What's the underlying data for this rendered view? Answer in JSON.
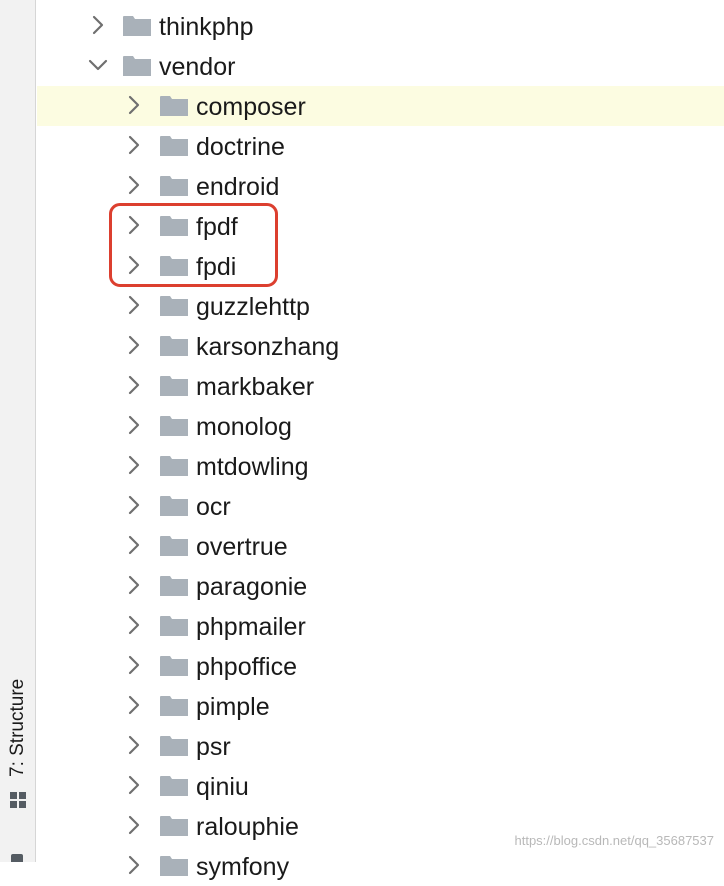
{
  "side_panel": {
    "structure_tab_label": "7: Structure"
  },
  "tree": {
    "root_items": [
      {
        "name": "thinkphp",
        "expanded": false
      },
      {
        "name": "vendor",
        "expanded": true
      }
    ],
    "vendor_children": [
      "composer",
      "doctrine",
      "endroid",
      "fpdf",
      "fpdi",
      "guzzlehttp",
      "karsonzhang",
      "markbaker",
      "monolog",
      "mtdowling",
      "ocr",
      "overtrue",
      "paragonie",
      "phpmailer",
      "phpoffice",
      "pimple",
      "psr",
      "qiniu",
      "ralouphie",
      "symfony"
    ],
    "selected_item": "composer",
    "highlighted_items": [
      "fpdf",
      "fpdi"
    ]
  },
  "colors": {
    "folder": "#a9b1b9",
    "arrow": "#6f6f6f",
    "selection": "#fcfce1",
    "highlight_border": "#dc3f2f"
  },
  "icons": {
    "collapsed": "chevron-right-icon",
    "expanded": "chevron-down-icon",
    "folder": "folder-icon",
    "structure": "structure-icon"
  },
  "watermark": "https://blog.csdn.net/qq_35687537"
}
